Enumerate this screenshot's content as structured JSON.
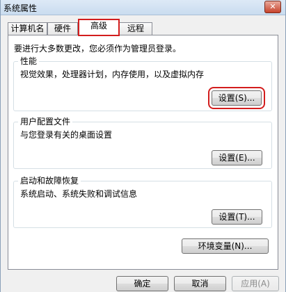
{
  "window": {
    "title": "系统属性",
    "close_icon": "close-icon"
  },
  "tabs": [
    {
      "label": "计算机名",
      "active": false
    },
    {
      "label": "硬件",
      "active": false
    },
    {
      "label": "高级",
      "active": true
    },
    {
      "label": "远程",
      "active": false
    }
  ],
  "advanced": {
    "notice": "要进行大多数更改，您必须作为管理员登录。",
    "performance": {
      "title": "性能",
      "description": "视觉效果，处理器计划，内存使用，以及虚拟内存",
      "button": "设置(S)..."
    },
    "user_profiles": {
      "title": "用户配置文件",
      "description": "与您登录有关的桌面设置",
      "button": "设置(E)..."
    },
    "startup_recovery": {
      "title": "启动和故障恢复",
      "description": "系统启动、系统失败和调试信息",
      "button": "设置(T)..."
    },
    "env_button": "环境变量(N)..."
  },
  "footer": {
    "ok": "确定",
    "cancel": "取消",
    "apply": "应用(A)"
  },
  "colors": {
    "highlight": "#d31d1d",
    "panel": "#ffffff",
    "dialog": "#f0f0f0"
  }
}
